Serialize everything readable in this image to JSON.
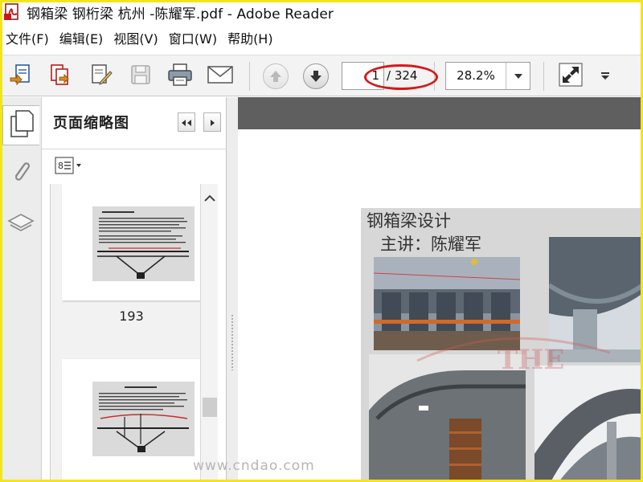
{
  "window": {
    "title": "钢箱梁 钢桁梁 杭州 -陈耀军.pdf - Adobe Reader"
  },
  "menu": [
    {
      "label": "文件(F)"
    },
    {
      "label": "编辑(E)"
    },
    {
      "label": "视图(V)"
    },
    {
      "label": "窗口(W)"
    },
    {
      "label": "帮助(H)"
    }
  ],
  "toolbar": {
    "current_page": "1",
    "total_pages": "/ 324",
    "zoom": "28.2%"
  },
  "sidebar": {
    "panel_title": "页面缩略图",
    "thumbnails": [
      {
        "page_label": "193"
      },
      {
        "page_label": ""
      }
    ]
  },
  "document": {
    "slide_title": "钢箱梁设计",
    "slide_subtitle": "主讲：陈耀军"
  },
  "watermark": "www.cndao.com",
  "colors": {
    "highlight_oval": "#d61818",
    "frame": "#f2e51c",
    "doc_background": "#5f5f5f"
  }
}
